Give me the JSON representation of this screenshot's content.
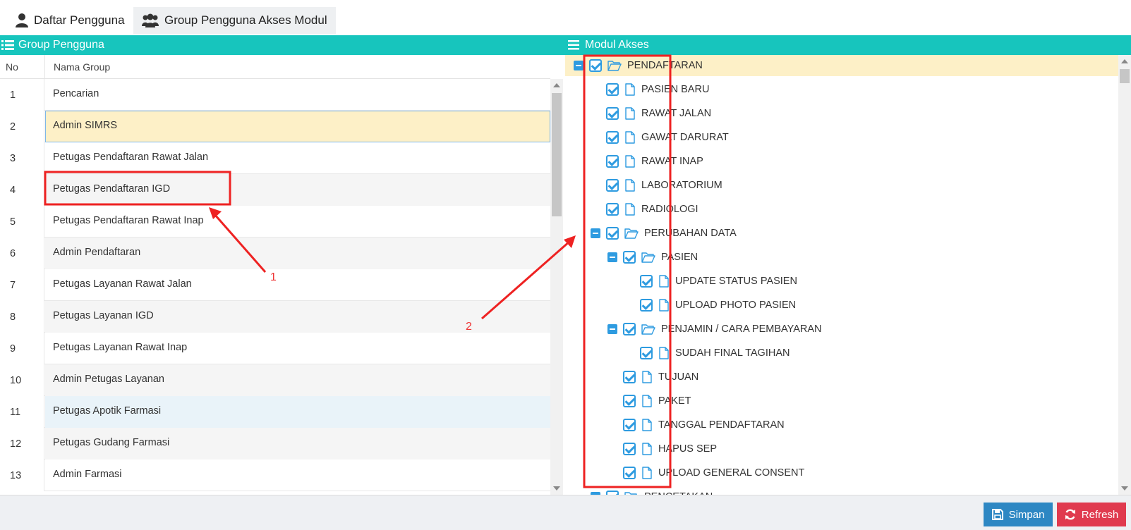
{
  "tabs": [
    {
      "label": "Daftar Pengguna",
      "active": false
    },
    {
      "label": "Group Pengguna Akses Modul",
      "active": true
    }
  ],
  "left_panel": {
    "title": "Group Pengguna",
    "columns": {
      "no": "No",
      "name": "Nama Group"
    },
    "rows": [
      {
        "no": "1",
        "name": "Pencarian"
      },
      {
        "no": "2",
        "name": "Admin SIMRS"
      },
      {
        "no": "3",
        "name": "Petugas Pendaftaran Rawat Jalan"
      },
      {
        "no": "4",
        "name": "Petugas Pendaftaran IGD"
      },
      {
        "no": "5",
        "name": "Petugas Pendaftaran Rawat Inap"
      },
      {
        "no": "6",
        "name": "Admin Pendaftaran"
      },
      {
        "no": "7",
        "name": "Petugas Layanan Rawat Jalan"
      },
      {
        "no": "8",
        "name": "Petugas Layanan IGD"
      },
      {
        "no": "9",
        "name": "Petugas Layanan Rawat Inap"
      },
      {
        "no": "10",
        "name": "Admin Petugas Layanan"
      },
      {
        "no": "11",
        "name": "Petugas Apotik Farmasi"
      },
      {
        "no": "12",
        "name": "Petugas Gudang Farmasi"
      },
      {
        "no": "13",
        "name": "Admin Farmasi"
      }
    ]
  },
  "right_panel": {
    "title": "Modul Akses",
    "tree": [
      {
        "label": "PENDAFTARAN",
        "level": 0,
        "folder": true,
        "highlight": true
      },
      {
        "label": "PASIEN BARU",
        "level": 1,
        "folder": false
      },
      {
        "label": "RAWAT JALAN",
        "level": 1,
        "folder": false
      },
      {
        "label": "GAWAT DARURAT",
        "level": 1,
        "folder": false
      },
      {
        "label": "RAWAT INAP",
        "level": 1,
        "folder": false
      },
      {
        "label": "LABORATORIUM",
        "level": 1,
        "folder": false
      },
      {
        "label": "RADIOLOGI",
        "level": 1,
        "folder": false
      },
      {
        "label": "PERUBAHAN DATA",
        "level": 1,
        "folder": true
      },
      {
        "label": "PASIEN",
        "level": 2,
        "folder": true
      },
      {
        "label": "UPDATE STATUS PASIEN",
        "level": 3,
        "folder": false
      },
      {
        "label": "UPLOAD PHOTO PASIEN",
        "level": 3,
        "folder": false
      },
      {
        "label": "PENJAMIN / CARA PEMBAYARAN",
        "level": 2,
        "folder": true
      },
      {
        "label": "SUDAH FINAL TAGIHAN",
        "level": 3,
        "folder": false
      },
      {
        "label": "TUJUAN",
        "level": 2,
        "folder": false
      },
      {
        "label": "PAKET",
        "level": 2,
        "folder": false
      },
      {
        "label": "TANGGAL PENDAFTARAN",
        "level": 2,
        "folder": false
      },
      {
        "label": "HAPUS SEP",
        "level": 2,
        "folder": false
      },
      {
        "label": "UPLOAD GENERAL CONSENT",
        "level": 2,
        "folder": false
      },
      {
        "label": "PENCETAKAN",
        "level": 1,
        "folder": true
      }
    ]
  },
  "footer": {
    "save_label": "Simpan",
    "refresh_label": "Refresh"
  },
  "annotations": {
    "one": "1",
    "two": "2"
  },
  "colors": {
    "header": "#17c5bd",
    "save": "#2d87c3",
    "refresh": "#e03a4f",
    "highlight": "#fdf0c7",
    "annotation": "#ee2222"
  }
}
